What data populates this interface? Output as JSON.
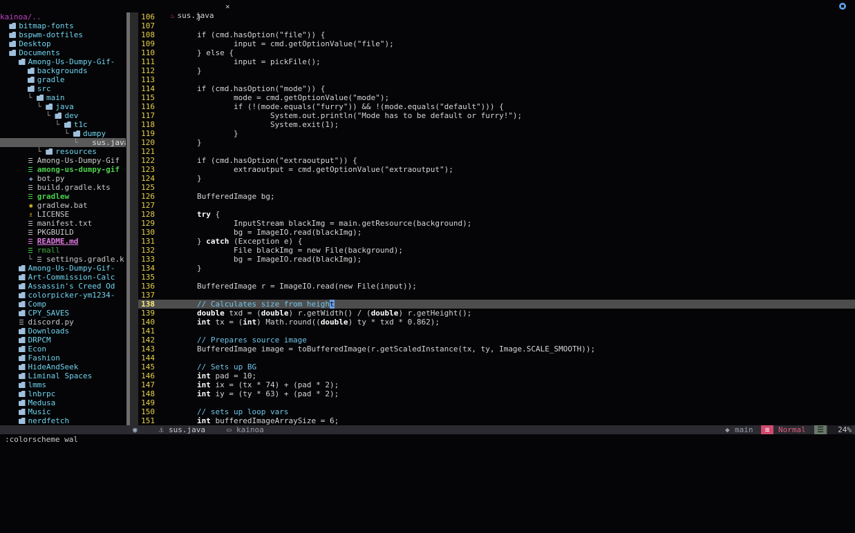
{
  "tab": {
    "title": "sus.java",
    "close": "×"
  },
  "tree": {
    "root": "kainoa/..",
    "rows": [
      {
        "indent": "",
        "kind": "dir",
        "name": "bitmap-fonts"
      },
      {
        "indent": "",
        "kind": "dir",
        "name": "bspwm-dotfiles"
      },
      {
        "indent": "",
        "kind": "dir",
        "name": "Desktop"
      },
      {
        "indent": "",
        "kind": "dir",
        "name": "Documents"
      },
      {
        "indent": "  ",
        "kind": "dir",
        "name": "Among-Us-Dumpy-Gif-"
      },
      {
        "indent": "    ",
        "kind": "dir",
        "name": "backgrounds"
      },
      {
        "indent": "    ",
        "kind": "dir",
        "name": "gradle"
      },
      {
        "indent": "    ",
        "kind": "dir",
        "name": "src"
      },
      {
        "indent": "    └ ",
        "kind": "dir",
        "name": "main"
      },
      {
        "indent": "      └ ",
        "kind": "dir",
        "name": "java"
      },
      {
        "indent": "        └ ",
        "kind": "dir",
        "name": "dev"
      },
      {
        "indent": "          └ ",
        "kind": "dir",
        "name": "t1c"
      },
      {
        "indent": "            └ ",
        "kind": "dir",
        "name": "dumpy"
      },
      {
        "indent": "              └ ",
        "kind": "sel",
        "name": "sus.java"
      },
      {
        "indent": "      └ ",
        "kind": "dir",
        "name": "resources"
      },
      {
        "indent": "    ",
        "kind": "file",
        "name": "Among-Us-Dumpy-Gif"
      },
      {
        "indent": "    ",
        "kind": "exe",
        "name": "among-us-dumpy-gif"
      },
      {
        "indent": "    ",
        "kind": "py",
        "name": "bot.py"
      },
      {
        "indent": "    ",
        "kind": "file",
        "name": "build.gradle.kts"
      },
      {
        "indent": "    ",
        "kind": "exe",
        "name": "gradlew"
      },
      {
        "indent": "    ",
        "kind": "gear",
        "name": "gradlew.bat"
      },
      {
        "indent": "    ",
        "kind": "license",
        "name": "LICENSE"
      },
      {
        "indent": "    ",
        "kind": "file",
        "name": "manifest.txt"
      },
      {
        "indent": "    ",
        "kind": "file",
        "name": "PKGBUILD"
      },
      {
        "indent": "    ",
        "kind": "readme",
        "name": "README.md"
      },
      {
        "indent": "    ",
        "kind": "rmall",
        "name": "rmall"
      },
      {
        "indent": "    └ ",
        "kind": "file",
        "name": "settings.gradle.k"
      },
      {
        "indent": "  ",
        "kind": "dir",
        "name": "Among-Us-Dumpy-Gif-"
      },
      {
        "indent": "  ",
        "kind": "dir",
        "name": "Art-Commission-Calc"
      },
      {
        "indent": "  ",
        "kind": "dir",
        "name": "Assassin's Creed Od"
      },
      {
        "indent": "  ",
        "kind": "dir",
        "name": "colorpicker-ym1234-"
      },
      {
        "indent": "  ",
        "kind": "dir",
        "name": "Comp"
      },
      {
        "indent": "  ",
        "kind": "dir",
        "name": "CPY_SAVES"
      },
      {
        "indent": "  ",
        "kind": "file",
        "name": "discord.py"
      },
      {
        "indent": "  ",
        "kind": "dir",
        "name": "Downloads"
      },
      {
        "indent": "  ",
        "kind": "dir",
        "name": "DRPCM"
      },
      {
        "indent": "  ",
        "kind": "dir",
        "name": "Econ"
      },
      {
        "indent": "  ",
        "kind": "dir",
        "name": "Fashion"
      },
      {
        "indent": "  ",
        "kind": "dir",
        "name": "HideAndSeek"
      },
      {
        "indent": "  ",
        "kind": "dir",
        "name": "Liminal Spaces"
      },
      {
        "indent": "  ",
        "kind": "dir",
        "name": "lmms"
      },
      {
        "indent": "  ",
        "kind": "dir",
        "name": "lnbrpc"
      },
      {
        "indent": "  ",
        "kind": "dir",
        "name": "Medusa"
      },
      {
        "indent": "  ",
        "kind": "dir",
        "name": "Music"
      },
      {
        "indent": "  ",
        "kind": "dir",
        "name": "nerdfetch"
      }
    ]
  },
  "code": {
    "current_line": "138",
    "lines": [
      {
        "n": "106",
        "t": "        }"
      },
      {
        "n": "107",
        "t": ""
      },
      {
        "n": "108",
        "t": "        if (cmd.hasOption(\"file\")) {"
      },
      {
        "n": "109",
        "t": "                input = cmd.getOptionValue(\"file\");"
      },
      {
        "n": "110",
        "t": "        } else {"
      },
      {
        "n": "111",
        "t": "                input = pickFile();"
      },
      {
        "n": "112",
        "t": "        }"
      },
      {
        "n": "113",
        "t": ""
      },
      {
        "n": "114",
        "t": "        if (cmd.hasOption(\"mode\")) {"
      },
      {
        "n": "115",
        "t": "                mode = cmd.getOptionValue(\"mode\");"
      },
      {
        "n": "116",
        "t": "                if (!(mode.equals(\"furry\")) && !(mode.equals(\"default\"))) {"
      },
      {
        "n": "117",
        "t": "                        System.out.println(\"Mode has to be default or furry!\");"
      },
      {
        "n": "118",
        "t": "                        System.exit(1);"
      },
      {
        "n": "119",
        "t": "                }"
      },
      {
        "n": "120",
        "t": "        }"
      },
      {
        "n": "121",
        "t": ""
      },
      {
        "n": "122",
        "t": "        if (cmd.hasOption(\"extraoutput\")) {"
      },
      {
        "n": "123",
        "t": "                extraoutput = cmd.getOptionValue(\"extraoutput\");"
      },
      {
        "n": "124",
        "t": "        }"
      },
      {
        "n": "125",
        "t": ""
      },
      {
        "n": "126",
        "t": "        BufferedImage bg;"
      },
      {
        "n": "127",
        "t": ""
      },
      {
        "n": "128",
        "t": "        try {"
      },
      {
        "n": "129",
        "t": "                InputStream blackImg = main.getResource(background);"
      },
      {
        "n": "130",
        "t": "                bg = ImageIO.read(blackImg);"
      },
      {
        "n": "131",
        "t": "        } catch (Exception e) {"
      },
      {
        "n": "132",
        "t": "                File blackImg = new File(background);"
      },
      {
        "n": "133",
        "t": "                bg = ImageIO.read(blackImg);"
      },
      {
        "n": "134",
        "t": "        }"
      },
      {
        "n": "135",
        "t": ""
      },
      {
        "n": "136",
        "t": "        BufferedImage r = ImageIO.read(new File(input));"
      },
      {
        "n": "137",
        "t": ""
      },
      {
        "n": "138",
        "t": "        // Calculates size from height"
      },
      {
        "n": "139",
        "t": "        double txd = (double) r.getWidth() / (double) r.getHeight();"
      },
      {
        "n": "140",
        "t": "        int tx = (int) Math.round((double) ty * txd * 0.862);"
      },
      {
        "n": "141",
        "t": ""
      },
      {
        "n": "142",
        "t": "        // Prepares source image"
      },
      {
        "n": "143",
        "t": "        BufferedImage image = toBufferedImage(r.getScaledInstance(tx, ty, Image.SCALE_SMOOTH));"
      },
      {
        "n": "144",
        "t": ""
      },
      {
        "n": "145",
        "t": "        // Sets up BG"
      },
      {
        "n": "146",
        "t": "        int pad = 10;"
      },
      {
        "n": "147",
        "t": "        int ix = (tx * 74) + (pad * 2);"
      },
      {
        "n": "148",
        "t": "        int iy = (ty * 63) + (pad * 2);"
      },
      {
        "n": "149",
        "t": ""
      },
      {
        "n": "150",
        "t": "        // sets up loop vars"
      },
      {
        "n": "151",
        "t": "        int bufferedImageArraySize = 6;"
      }
    ]
  },
  "status": {
    "file": "sus.java",
    "dir": "kainoa",
    "branch": "main",
    "mode": "Normal",
    "percent": "24%"
  },
  "cmdline": ":colorscheme wal",
  "colors": {
    "accent": "#6fd4ee",
    "mode": "#d14a6e",
    "linenr": "#e8d04a"
  }
}
